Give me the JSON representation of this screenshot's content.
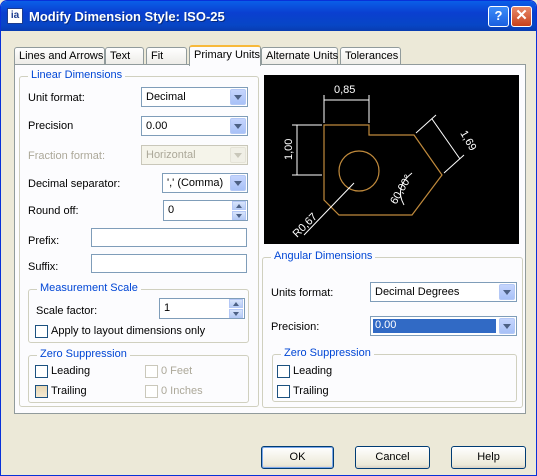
{
  "window": {
    "title": "Modify Dimension Style: ISO-25",
    "help_glyph": "?",
    "close_glyph": "✕"
  },
  "tabs": [
    {
      "label": "Lines and Arrows"
    },
    {
      "label": "Text"
    },
    {
      "label": "Fit"
    },
    {
      "label": "Primary Units",
      "active": true
    },
    {
      "label": "Alternate Units"
    },
    {
      "label": "Tolerances"
    }
  ],
  "linear": {
    "title": "Linear Dimensions",
    "unit_format": {
      "label": "Unit format:",
      "value": "Decimal"
    },
    "precision": {
      "label": "Precision",
      "value": "0.00"
    },
    "fraction_format": {
      "label": "Fraction format:",
      "value": "Horizontal"
    },
    "decimal_separator": {
      "label": "Decimal separator:",
      "value": "',' (Comma)"
    },
    "round_off": {
      "label": "Round off:",
      "value": "0"
    },
    "prefix": {
      "label": "Prefix:",
      "value": ""
    },
    "suffix": {
      "label": "Suffix:",
      "value": ""
    }
  },
  "measurement": {
    "title": "Measurement Scale",
    "scale_factor": {
      "label": "Scale factor:",
      "value": "1"
    },
    "layout_only": {
      "label": "Apply to layout dimensions only",
      "checked": false
    }
  },
  "zero_left": {
    "title": "Zero Suppression",
    "leading": "Leading",
    "trailing": "Trailing",
    "feet": "0 Feet",
    "inches": "0 Inches"
  },
  "preview": {
    "dims": [
      "0,85",
      "1,00",
      "1,69",
      "60,00°",
      "R0,67"
    ],
    "colors": {
      "geometry": "#c08a3c",
      "dimension": "#ffffff",
      "background": "#000000"
    }
  },
  "angular": {
    "title": "Angular Dimensions",
    "units_format": {
      "label": "Units format:",
      "value": "Decimal Degrees"
    },
    "precision": {
      "label": "Precision:",
      "value": "0.00"
    }
  },
  "zero_right": {
    "title": "Zero Suppression",
    "leading": "Leading",
    "trailing": "Trailing"
  },
  "buttons": {
    "ok": "OK",
    "cancel": "Cancel",
    "help": "Help"
  }
}
